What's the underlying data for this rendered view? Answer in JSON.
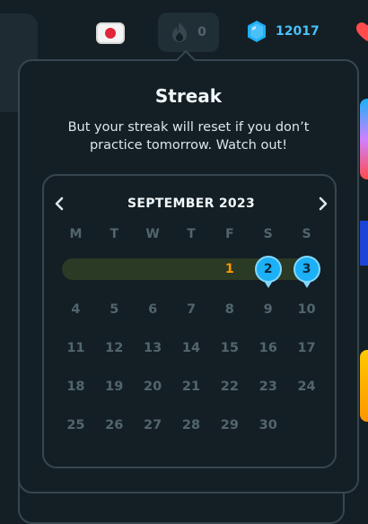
{
  "topbar": {
    "language_flag": "japanese-flag",
    "streak_count": "0",
    "gems_count": "12017"
  },
  "popover": {
    "title": "Streak",
    "message": "But your streak will reset if you don’t practice tomorrow. Watch out!"
  },
  "calendar": {
    "month": "SEPTEMBER 2023",
    "weekdays": [
      "M",
      "T",
      "W",
      "T",
      "F",
      "S",
      "S"
    ],
    "week1": [
      "",
      "",
      "",
      "",
      "1",
      "2",
      "3"
    ],
    "weeks": [
      [
        "4",
        "5",
        "6",
        "7",
        "8",
        "9",
        "10"
      ],
      [
        "11",
        "12",
        "13",
        "14",
        "15",
        "16",
        "17"
      ],
      [
        "18",
        "19",
        "20",
        "21",
        "22",
        "23",
        "24"
      ],
      [
        "25",
        "26",
        "27",
        "28",
        "29",
        "30",
        ""
      ]
    ]
  },
  "colors": {
    "today": "#ff9600",
    "streak_marker": "#1cb0f6",
    "inactive_text": "#52656d",
    "border": "#37464f",
    "background": "#131f24"
  }
}
